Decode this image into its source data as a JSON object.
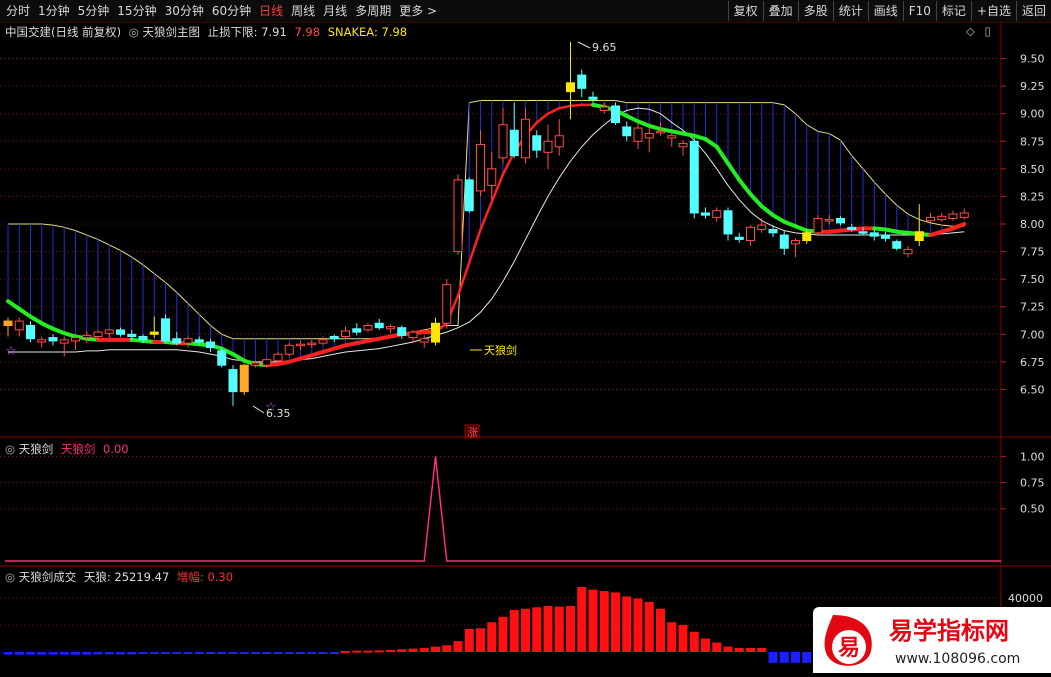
{
  "toolbar": {
    "periods": [
      "分时",
      "1分钟",
      "5分钟",
      "15分钟",
      "30分钟",
      "60分钟",
      "日线",
      "周线",
      "月线",
      "多周期",
      "更多 >"
    ],
    "active_period": "日线",
    "right_buttons": [
      "复权",
      "叠加",
      "多股",
      "统计",
      "画线",
      "F10",
      "标记",
      "+自选",
      "返回"
    ]
  },
  "main_panel": {
    "stock": "中国交建(日线 前复权)",
    "indicator": "天狼剑主图",
    "stop_label": "止损下限:",
    "stop_value": "7.91",
    "stop_value2": "7.98",
    "snake_label": "SNAKEA:",
    "snake_value": "7.98",
    "max_label": "9.65",
    "min_label": "6.35",
    "signal_label": "天狼剑",
    "rise_marker": "涨",
    "y_ticks": [
      "9.50",
      "9.25",
      "9.00",
      "8.75",
      "8.50",
      "8.25",
      "8.00",
      "7.75",
      "7.50",
      "7.25",
      "7.00",
      "6.75",
      "6.50"
    ]
  },
  "panel2": {
    "name": "天狼剑",
    "series_label": "天狼剑",
    "series_value": "0.00",
    "y_ticks": [
      "1.00",
      "0.75",
      "0.50"
    ]
  },
  "panel3": {
    "name": "天狼剑成交",
    "label1": "天狼:",
    "value1": "25219.47",
    "label2": "增幅:",
    "value2": "0.30",
    "y_ticks": [
      "40000"
    ]
  },
  "watermark": {
    "logo_char": "易",
    "title": "易学指标网",
    "url": "www.108096.com"
  },
  "colors": {
    "up": "#ff4a4a",
    "down": "#54ffff",
    "green_line": "#22ee22",
    "red_line": "#ff2020",
    "fan": "#1e2ed8",
    "yellow_line": "#e8e07a",
    "white_line": "#e8e8e8",
    "signal_yellow": "#ffe600",
    "signal_orange": "#ffa726",
    "vol_red": "#ff1010",
    "vol_blue": "#1a20ff",
    "pink": "#ff2d7a"
  },
  "chart_data": {
    "type": "candlestick",
    "ylim": [
      6.35,
      9.65
    ],
    "candles": [
      {
        "o": 7.12,
        "h": 7.15,
        "l": 6.98,
        "c": 7.08,
        "tag": "orange"
      },
      {
        "o": 7.04,
        "h": 7.15,
        "l": 6.98,
        "c": 7.12
      },
      {
        "o": 7.08,
        "h": 7.12,
        "l": 6.93,
        "c": 6.96
      },
      {
        "o": 6.93,
        "h": 6.98,
        "l": 6.88,
        "c": 6.95
      },
      {
        "o": 6.97,
        "h": 7.0,
        "l": 6.9,
        "c": 6.94
      },
      {
        "o": 6.92,
        "h": 6.98,
        "l": 6.8,
        "c": 6.95
      },
      {
        "o": 6.94,
        "h": 6.99,
        "l": 6.86,
        "c": 6.97
      },
      {
        "o": 6.97,
        "h": 7.03,
        "l": 6.92,
        "c": 6.99
      },
      {
        "o": 6.98,
        "h": 7.04,
        "l": 6.95,
        "c": 7.02
      },
      {
        "o": 7.01,
        "h": 7.05,
        "l": 6.97,
        "c": 7.04
      },
      {
        "o": 7.04,
        "h": 7.06,
        "l": 6.98,
        "c": 7.0
      },
      {
        "o": 7.0,
        "h": 7.04,
        "l": 6.95,
        "c": 6.98
      },
      {
        "o": 6.98,
        "h": 7.0,
        "l": 6.92,
        "c": 6.95
      },
      {
        "o": 7.0,
        "h": 7.16,
        "l": 6.97,
        "c": 7.02,
        "tag": "yellow"
      },
      {
        "o": 7.14,
        "h": 7.18,
        "l": 6.92,
        "c": 6.94
      },
      {
        "o": 6.96,
        "h": 7.02,
        "l": 6.9,
        "c": 6.92
      },
      {
        "o": 6.92,
        "h": 6.98,
        "l": 6.88,
        "c": 6.96
      },
      {
        "o": 6.95,
        "h": 6.98,
        "l": 6.9,
        "c": 6.93
      },
      {
        "o": 6.93,
        "h": 6.96,
        "l": 6.84,
        "c": 6.88
      },
      {
        "o": 6.85,
        "h": 6.88,
        "l": 6.7,
        "c": 6.72
      },
      {
        "o": 6.68,
        "h": 6.72,
        "l": 6.35,
        "c": 6.48
      },
      {
        "o": 6.48,
        "h": 6.73,
        "l": 6.45,
        "c": 6.72,
        "tag": "orange"
      },
      {
        "o": 6.72,
        "h": 6.76,
        "l": 6.7,
        "c": 6.74
      },
      {
        "o": 6.72,
        "h": 6.78,
        "l": 6.7,
        "c": 6.77
      },
      {
        "o": 6.76,
        "h": 6.84,
        "l": 6.74,
        "c": 6.82
      },
      {
        "o": 6.82,
        "h": 6.92,
        "l": 6.8,
        "c": 6.9
      },
      {
        "o": 6.9,
        "h": 6.94,
        "l": 6.86,
        "c": 6.91
      },
      {
        "o": 6.91,
        "h": 6.95,
        "l": 6.88,
        "c": 6.92
      },
      {
        "o": 6.92,
        "h": 6.98,
        "l": 6.9,
        "c": 6.95
      },
      {
        "o": 6.98,
        "h": 7.0,
        "l": 6.93,
        "c": 6.96
      },
      {
        "o": 6.98,
        "h": 7.07,
        "l": 6.96,
        "c": 7.03
      },
      {
        "o": 7.05,
        "h": 7.1,
        "l": 6.99,
        "c": 7.02
      },
      {
        "o": 7.04,
        "h": 7.1,
        "l": 7.02,
        "c": 7.08
      },
      {
        "o": 7.1,
        "h": 7.14,
        "l": 7.04,
        "c": 7.06
      },
      {
        "o": 7.05,
        "h": 7.09,
        "l": 7.01,
        "c": 7.07
      },
      {
        "o": 7.06,
        "h": 7.08,
        "l": 6.96,
        "c": 6.99
      },
      {
        "o": 6.97,
        "h": 7.04,
        "l": 6.92,
        "c": 7.02
      },
      {
        "o": 6.93,
        "h": 6.99,
        "l": 6.88,
        "c": 6.96
      },
      {
        "o": 6.93,
        "h": 7.15,
        "l": 6.9,
        "c": 7.1,
        "tag": "yellow"
      },
      {
        "o": 7.1,
        "h": 7.5,
        "l": 7.05,
        "c": 7.45
      },
      {
        "o": 7.75,
        "h": 8.45,
        "l": 7.72,
        "c": 8.4
      },
      {
        "o": 8.4,
        "h": 8.42,
        "l": 8.1,
        "c": 8.12
      },
      {
        "o": 8.3,
        "h": 8.85,
        "l": 8.25,
        "c": 8.72
      },
      {
        "o": 8.35,
        "h": 8.65,
        "l": 8.22,
        "c": 8.5
      },
      {
        "o": 8.6,
        "h": 9.05,
        "l": 8.55,
        "c": 8.9
      },
      {
        "o": 8.85,
        "h": 9.1,
        "l": 8.6,
        "c": 8.62
      },
      {
        "o": 8.6,
        "h": 9.05,
        "l": 8.55,
        "c": 8.95
      },
      {
        "o": 8.8,
        "h": 8.85,
        "l": 8.6,
        "c": 8.67
      },
      {
        "o": 8.65,
        "h": 8.9,
        "l": 8.5,
        "c": 8.75
      },
      {
        "o": 8.7,
        "h": 8.95,
        "l": 8.62,
        "c": 8.8
      },
      {
        "o": 9.2,
        "h": 9.65,
        "l": 8.95,
        "c": 9.28,
        "tag": "yellow"
      },
      {
        "o": 9.35,
        "h": 9.4,
        "l": 9.15,
        "c": 9.23
      },
      {
        "o": 9.15,
        "h": 9.2,
        "l": 9.1,
        "c": 9.13
      },
      {
        "o": 9.03,
        "h": 9.1,
        "l": 9.0,
        "c": 9.06
      },
      {
        "o": 9.07,
        "h": 9.1,
        "l": 8.9,
        "c": 8.92
      },
      {
        "o": 8.88,
        "h": 8.93,
        "l": 8.75,
        "c": 8.8
      },
      {
        "o": 8.75,
        "h": 8.92,
        "l": 8.68,
        "c": 8.87
      },
      {
        "o": 8.78,
        "h": 8.88,
        "l": 8.65,
        "c": 8.82
      },
      {
        "o": 8.84,
        "h": 8.92,
        "l": 8.8,
        "c": 8.84
      },
      {
        "o": 8.78,
        "h": 8.84,
        "l": 8.7,
        "c": 8.8
      },
      {
        "o": 8.7,
        "h": 8.76,
        "l": 8.62,
        "c": 8.73
      },
      {
        "o": 8.75,
        "h": 8.78,
        "l": 8.05,
        "c": 8.1
      },
      {
        "o": 8.1,
        "h": 8.15,
        "l": 8.05,
        "c": 8.08
      },
      {
        "o": 8.06,
        "h": 8.15,
        "l": 8.02,
        "c": 8.12
      },
      {
        "o": 8.12,
        "h": 8.15,
        "l": 7.85,
        "c": 7.91
      },
      {
        "o": 7.88,
        "h": 7.92,
        "l": 7.83,
        "c": 7.86
      },
      {
        "o": 7.85,
        "h": 7.99,
        "l": 7.8,
        "c": 7.97
      },
      {
        "o": 7.95,
        "h": 8.05,
        "l": 7.92,
        "c": 7.99
      },
      {
        "o": 7.95,
        "h": 7.99,
        "l": 7.88,
        "c": 7.92
      },
      {
        "o": 7.9,
        "h": 7.94,
        "l": 7.72,
        "c": 7.78
      },
      {
        "o": 7.82,
        "h": 7.87,
        "l": 7.7,
        "c": 7.85
      },
      {
        "o": 7.85,
        "h": 7.95,
        "l": 7.82,
        "c": 7.92,
        "tag": "yellow"
      },
      {
        "o": 7.92,
        "h": 8.08,
        "l": 7.9,
        "c": 8.05
      },
      {
        "o": 8.03,
        "h": 8.08,
        "l": 8.0,
        "c": 8.04
      },
      {
        "o": 8.05,
        "h": 8.07,
        "l": 7.99,
        "c": 8.01
      },
      {
        "o": 7.97,
        "h": 8.0,
        "l": 7.93,
        "c": 7.95
      },
      {
        "o": 7.93,
        "h": 7.97,
        "l": 7.9,
        "c": 7.92
      },
      {
        "o": 7.92,
        "h": 7.95,
        "l": 7.85,
        "c": 7.89
      },
      {
        "o": 7.9,
        "h": 7.93,
        "l": 7.84,
        "c": 7.87
      },
      {
        "o": 7.84,
        "h": 7.86,
        "l": 7.76,
        "c": 7.78
      },
      {
        "o": 7.73,
        "h": 7.8,
        "l": 7.7,
        "c": 7.77
      },
      {
        "o": 7.85,
        "h": 8.18,
        "l": 7.8,
        "c": 7.93,
        "tag": "yellow"
      },
      {
        "o": 8.03,
        "h": 8.1,
        "l": 8.0,
        "c": 8.06
      },
      {
        "o": 8.04,
        "h": 8.1,
        "l": 8.02,
        "c": 8.07
      },
      {
        "o": 8.05,
        "h": 8.12,
        "l": 8.03,
        "c": 8.09
      },
      {
        "o": 8.06,
        "h": 8.14,
        "l": 8.04,
        "c": 8.1
      }
    ],
    "signal_series": {
      "values": [
        0,
        0,
        0,
        0,
        0,
        0,
        0,
        0,
        0,
        0,
        0,
        0,
        0,
        0,
        0,
        0,
        0,
        0,
        0,
        0,
        0,
        0,
        0,
        0,
        0,
        0,
        0,
        0,
        0,
        0,
        0,
        0,
        0,
        0,
        0,
        0,
        0,
        0,
        1,
        0,
        0,
        0,
        0,
        0,
        0,
        0,
        0,
        0,
        0,
        0,
        0,
        0,
        0,
        0,
        0,
        0,
        0,
        0,
        0,
        0,
        0,
        0,
        0,
        0,
        0,
        0,
        0,
        0,
        0,
        0,
        0,
        0,
        0,
        0,
        0,
        0,
        0,
        0,
        0,
        0,
        0,
        0,
        0,
        0,
        0,
        0
      ],
      "ylim": [
        0,
        1.1
      ]
    },
    "volume_series": {
      "ylim": [
        -15000,
        55000
      ],
      "values": [
        -2000,
        -2000,
        -2000,
        -2000,
        -2000,
        -2000,
        -2000,
        -2000,
        -1800,
        -1800,
        -1800,
        -1800,
        -1500,
        -1500,
        -1500,
        -1500,
        -1500,
        -1500,
        -1500,
        -1500,
        -1500,
        -1400,
        -1300,
        -1300,
        -1200,
        -1200,
        -1000,
        -1000,
        -800,
        -800,
        800,
        1000,
        1000,
        1200,
        1500,
        2000,
        2500,
        3000,
        4000,
        5000,
        8000,
        17000,
        17500,
        22000,
        26000,
        31000,
        32000,
        33000,
        34000,
        33500,
        34000,
        48000,
        46000,
        45000,
        44000,
        41000,
        39500,
        37000,
        32000,
        22000,
        20000,
        15000,
        10000,
        7000,
        4000,
        3000,
        3000,
        3000,
        -8000,
        -8000,
        -8000,
        -8000,
        -8000,
        -8000,
        -7000,
        -6000,
        -5000,
        -5000,
        -4000,
        -4000,
        -4000,
        -4000,
        -4000,
        -3000,
        -3000,
        -3000
      ]
    }
  }
}
